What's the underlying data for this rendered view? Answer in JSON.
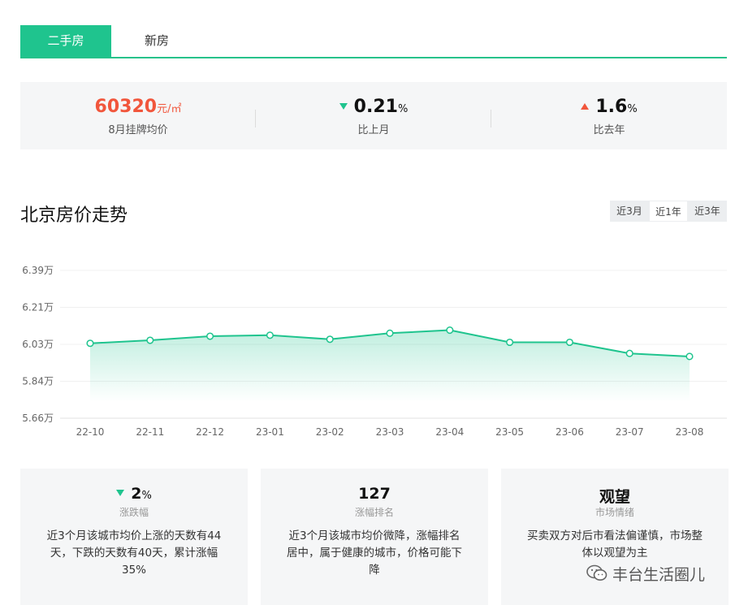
{
  "tabs": [
    {
      "label": "二手房",
      "active": true
    },
    {
      "label": "新房",
      "active": false
    }
  ],
  "summary": {
    "price": {
      "value": "60320",
      "unit": "元/㎡",
      "label": "8月挂牌均价"
    },
    "mom": {
      "value": "0.21",
      "unit": "%",
      "label": "比上月",
      "direction": "down"
    },
    "yoy": {
      "value": "1.6",
      "unit": "%",
      "label": "比去年",
      "direction": "up"
    }
  },
  "section_title": "北京房价走势",
  "range_tabs": [
    {
      "label": "近3月",
      "active": false
    },
    {
      "label": "近1年",
      "active": true
    },
    {
      "label": "近3年",
      "active": false
    }
  ],
  "colors": {
    "accent": "#1fc48e",
    "up": "#f1563c",
    "down": "#1fc48e",
    "panel": "#f5f6f7"
  },
  "chart_data": {
    "type": "area",
    "categories": [
      "22-10",
      "22-11",
      "22-12",
      "23-01",
      "23-02",
      "23-03",
      "23-04",
      "23-05",
      "23-06",
      "23-07",
      "23-08"
    ],
    "series": [
      {
        "values": [
          6.03,
          6.045,
          6.065,
          6.07,
          6.05,
          6.08,
          6.095,
          6.035,
          6.035,
          5.98,
          5.965
        ]
      }
    ],
    "yticks": [
      "6.39万",
      "6.21万",
      "6.03万",
      "5.84万",
      "5.66万"
    ],
    "ylim": [
      5.66,
      6.39
    ],
    "grid": true
  },
  "cards": [
    {
      "head_value": "2",
      "head_unit": "%",
      "direction": "down",
      "caption": "涨跌幅",
      "desc": "近3个月该城市均价上涨的天数有44天，下跌的天数有40天，累计涨幅35%"
    },
    {
      "head_value": "127",
      "head_unit": "",
      "caption": "涨幅排名",
      "desc": "近3个月该城市均价微降，涨幅排名居中，属于健康的城市，价格可能下降"
    },
    {
      "head_value": "观望",
      "head_unit": "",
      "caption": "市场情绪",
      "desc": "买卖双方对后市看法偏谨慎，市场整体以观望为主"
    }
  ],
  "watermark": "丰台生活圈儿"
}
